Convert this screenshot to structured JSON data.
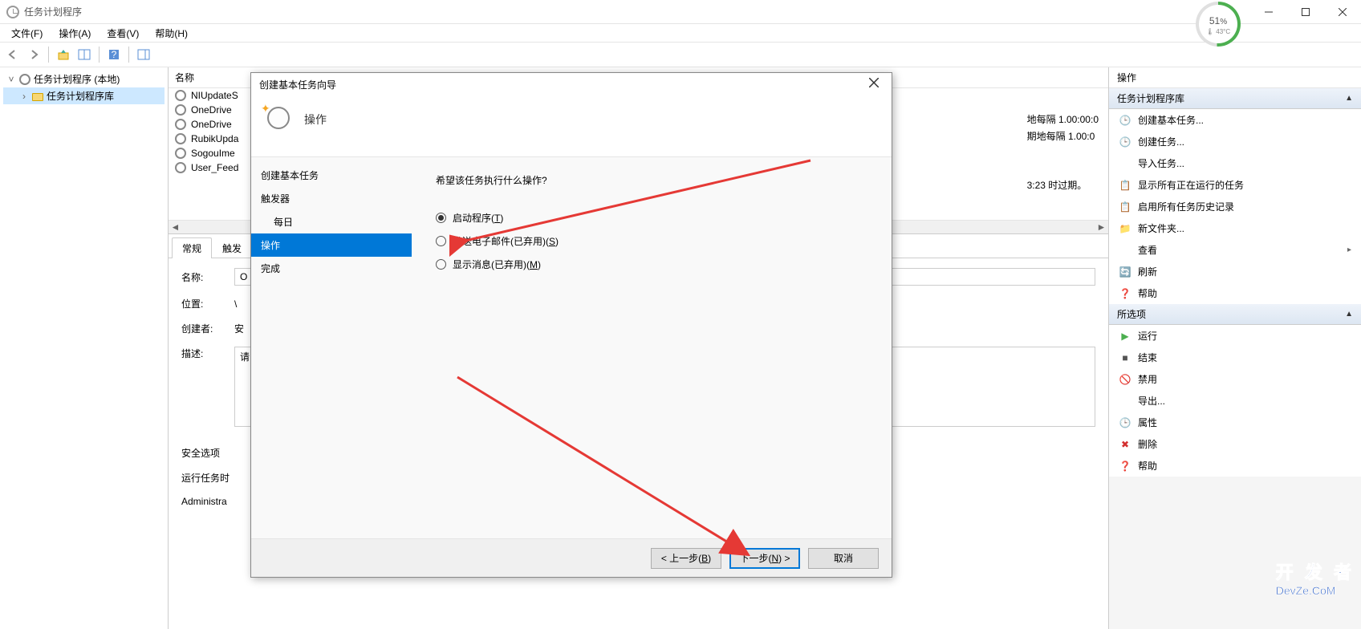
{
  "window": {
    "title": "任务计划程序"
  },
  "perf": {
    "percent": "51",
    "pct_sign": "%",
    "temp": "🌡 43°C"
  },
  "menu": {
    "file": "文件(F)",
    "action": "操作(A)",
    "view": "查看(V)",
    "help": "帮助(H)"
  },
  "tree": {
    "root": "任务计划程序 (本地)",
    "lib": "任务计划程序库"
  },
  "list": {
    "header_name": "名称",
    "rows": [
      {
        "name": "NIUpdateS"
      },
      {
        "name": "OneDrive"
      },
      {
        "name": "OneDrive"
      },
      {
        "name": "RubikUpda"
      },
      {
        "name": "SogouIme"
      },
      {
        "name": "User_Feed"
      }
    ],
    "triggers": [
      "地每隔 1.00:00:0",
      "期地每隔 1.00:0",
      "",
      "",
      "3:23 时过期。"
    ]
  },
  "details": {
    "tabs": [
      "常规",
      "触发"
    ],
    "name_label": "名称:",
    "name_value": "O",
    "location_label": "位置:",
    "location_value": "\\",
    "author_label": "创建者:",
    "author_value": "安",
    "desc_label": "描述:",
    "desc_value": "请",
    "security_header": "安全选项",
    "run_label": "运行任务时",
    "admin_label": "Administra"
  },
  "actions": {
    "header": "操作",
    "section1": "任务计划程序库",
    "items1": [
      {
        "icon": "🕒",
        "label": "创建基本任务..."
      },
      {
        "icon": "🕒",
        "label": "创建任务..."
      },
      {
        "icon": "",
        "label": "导入任务..."
      },
      {
        "icon": "📋",
        "label": "显示所有正在运行的任务"
      },
      {
        "icon": "📋",
        "label": "启用所有任务历史记录"
      },
      {
        "icon": "📁",
        "label": "新文件夹..."
      },
      {
        "icon": "",
        "label": "查看",
        "expand": "▸"
      },
      {
        "icon": "🔄",
        "label": "刷新"
      },
      {
        "icon": "❓",
        "label": "帮助"
      }
    ],
    "section2": "所选项",
    "items2": [
      {
        "icon": "▶",
        "label": "运行",
        "color": "#4CAF50"
      },
      {
        "icon": "■",
        "label": "结束",
        "color": "#555"
      },
      {
        "icon": "🚫",
        "label": "禁用"
      },
      {
        "icon": "",
        "label": "导出..."
      },
      {
        "icon": "🕒",
        "label": "属性"
      },
      {
        "icon": "✖",
        "label": "删除",
        "color": "#d32f2f"
      },
      {
        "icon": "❓",
        "label": "帮助"
      }
    ]
  },
  "dialog": {
    "title": "创建基本任务向导",
    "header": "操作",
    "steps": [
      {
        "label": "创建基本任务",
        "sub": false
      },
      {
        "label": "触发器",
        "sub": false
      },
      {
        "label": "每日",
        "sub": true
      },
      {
        "label": "操作",
        "sub": false,
        "selected": true
      },
      {
        "label": "完成",
        "sub": false
      }
    ],
    "prompt": "希望该任务执行什么操作?",
    "options": [
      {
        "label_pre": "启动程序(",
        "key": "T",
        "label_post": ")",
        "checked": true
      },
      {
        "label_pre": "发送电子邮件(已弃用)(",
        "key": "S",
        "label_post": ")",
        "checked": false
      },
      {
        "label_pre": "显示消息(已弃用)(",
        "key": "M",
        "label_post": ")",
        "checked": false
      }
    ],
    "btn_back_pre": "< 上一步(",
    "btn_back_key": "B",
    "btn_back_post": ")",
    "btn_next_pre": "下一步(",
    "btn_next_key": "N",
    "btn_next_post": ") >",
    "btn_cancel": "取消"
  },
  "watermark": {
    "line1": "开 发 者",
    "line2": "DevZe.CoM"
  }
}
